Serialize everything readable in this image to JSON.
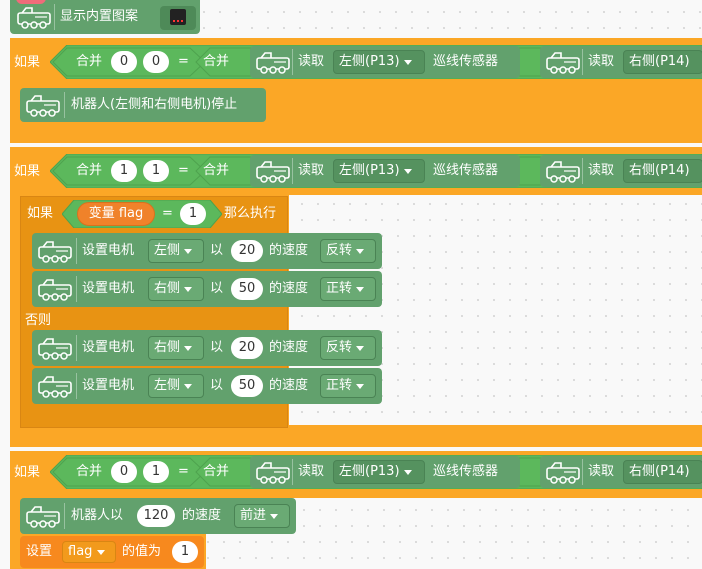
{
  "top": {
    "label": "显示内置图案"
  },
  "if1": {
    "if_label": "如果",
    "merge_label": "合并",
    "v1": "0",
    "v2": "0",
    "equals": "=",
    "read_label": "读取",
    "left_sensor": "左侧(P13)",
    "sensor_name": "巡线传感器",
    "right_sensor": "右侧(P14)",
    "action": "机器人(左侧和右侧电机)停止"
  },
  "if2": {
    "if_label": "如果",
    "merge_label": "合并",
    "v1": "1",
    "v2": "1",
    "equals": "=",
    "read_label": "读取",
    "left_sensor": "左侧(P13)",
    "sensor_name": "巡线传感器",
    "right_sensor": "右侧(P14)",
    "inner_if": {
      "if_label": "如果",
      "var_label": "变量 flag",
      "equals": "=",
      "value": "1",
      "then_label": "那么执行",
      "else_label": "否则"
    },
    "motors": [
      {
        "label": "设置电机",
        "side": "左侧",
        "with": "以",
        "speed": "20",
        "speed_suffix": "的速度",
        "dir": "反转"
      },
      {
        "label": "设置电机",
        "side": "右侧",
        "with": "以",
        "speed": "50",
        "speed_suffix": "的速度",
        "dir": "正转"
      },
      {
        "label": "设置电机",
        "side": "右侧",
        "with": "以",
        "speed": "20",
        "speed_suffix": "的速度",
        "dir": "反转"
      },
      {
        "label": "设置电机",
        "side": "左侧",
        "with": "以",
        "speed": "50",
        "speed_suffix": "的速度",
        "dir": "正转"
      }
    ]
  },
  "if3": {
    "if_label": "如果",
    "merge_label": "合并",
    "v1": "0",
    "v2": "1",
    "equals": "=",
    "read_label": "读取",
    "left_sensor": "左侧(P13)",
    "sensor_name": "巡线传感器",
    "right_sensor": "右侧(P14)",
    "robot_label": "机器人以",
    "speed": "120",
    "speed_suffix": "的速度",
    "dir": "前进",
    "set_label": "设置",
    "var": "flag",
    "value_label": "的值为",
    "value": "1"
  },
  "colors": {
    "control": "#fba726",
    "robot": "#62a16d",
    "operator": "#5cb85c",
    "variable": "#f0822a"
  },
  "icons": {
    "robot": "robot-car-icon",
    "dropdown": "caret-down-icon",
    "led": "led-matrix-icon"
  }
}
